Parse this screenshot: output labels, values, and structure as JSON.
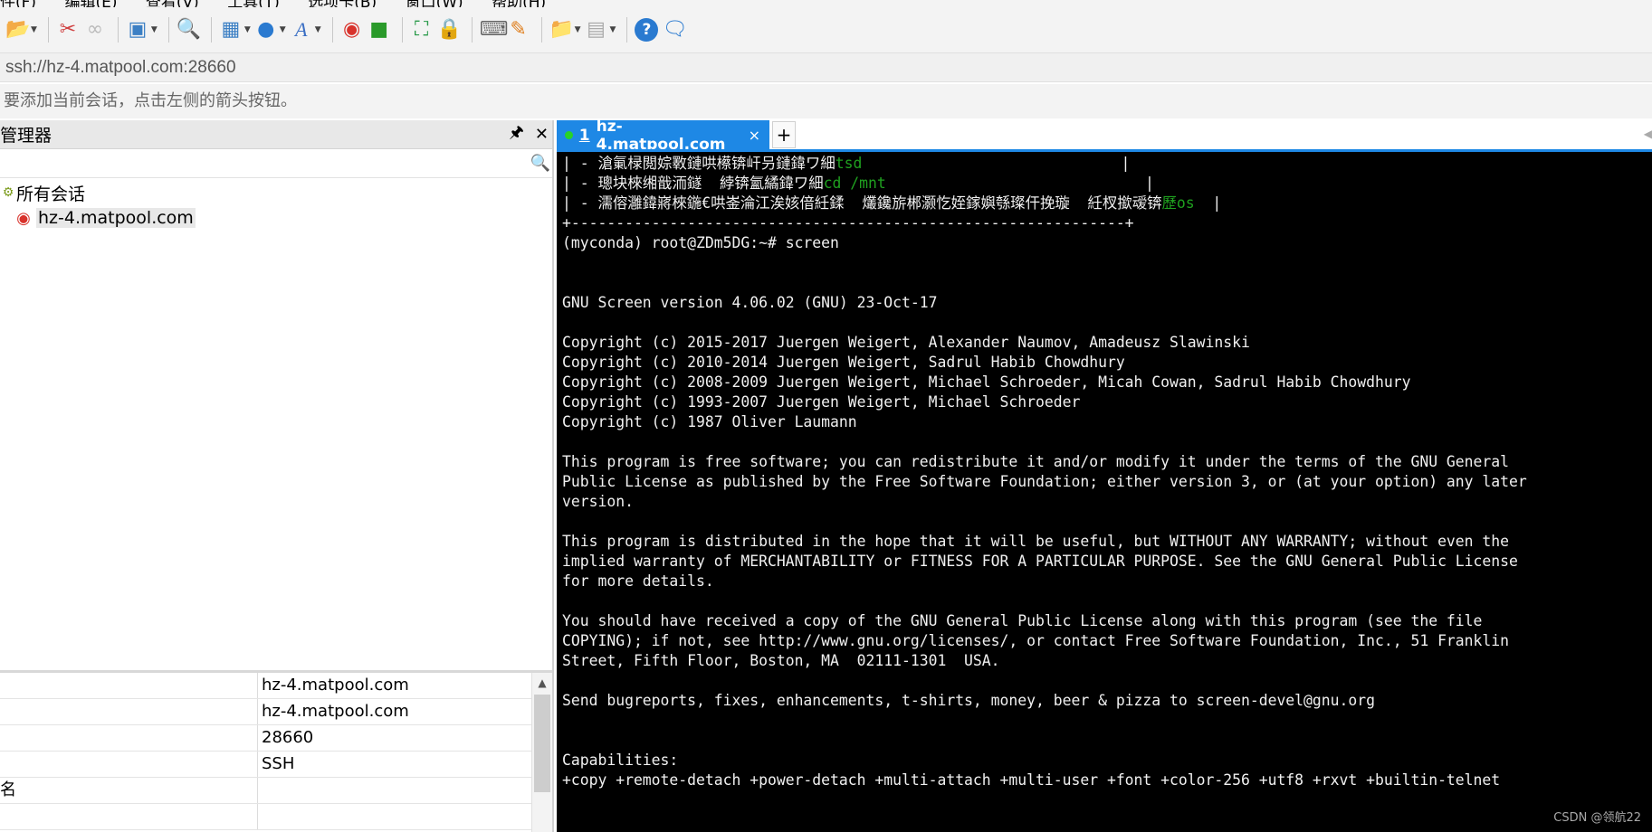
{
  "menubar": {
    "items": [
      "件(F)",
      "编辑(E)",
      "查看(V)",
      "工具(T)",
      "选项卡(B)",
      "窗口(W)",
      "帮助(H)"
    ]
  },
  "toolbar": {
    "icons": [
      "folder-icon",
      "disconnect-icon",
      "reconnect-icon",
      "new-session-icon",
      "find-icon",
      "layout-icon",
      "globe-icon",
      "font-icon",
      "xftp-icon",
      "xshell-green-icon",
      "fullscreen-icon",
      "lock-icon",
      "keyboard-icon",
      "highlight-icon",
      "transfer-icon",
      "tile-icon",
      "help-icon",
      "chat-icon"
    ]
  },
  "address": {
    "value": "ssh://hz-4.matpool.com:28660"
  },
  "hint": {
    "text": "要添加当前会话，点击左侧的箭头按钮。"
  },
  "session_manager": {
    "title": "管理器",
    "pin_label": "📌",
    "close_label": "✕",
    "search_placeholder": "",
    "tree": {
      "root_label": "所有会话",
      "host_label": "hz-4.matpool.com"
    },
    "properties": [
      {
        "key": "",
        "value": "hz-4.matpool.com"
      },
      {
        "key": "",
        "value": "hz-4.matpool.com"
      },
      {
        "key": "",
        "value": "28660"
      },
      {
        "key": "",
        "value": "SSH"
      },
      {
        "key": "名",
        "value": ""
      },
      {
        "key": "",
        "value": ""
      }
    ]
  },
  "tabs": [
    {
      "number": "1",
      "label": "hz-4.matpool.com",
      "status_color": "#28d228",
      "close": "×"
    }
  ],
  "tab_add": "+",
  "terminal": {
    "lines": [
      {
        "text": "| - 滄氭椂閲婃斁鏈哄櫒锛屽叧鏈鍏ワ細",
        "green": "tsd",
        "tail": "                             |"
      },
      {
        "text": "| - 璁块棶缃戠洏鐩  綍锛氳繘鍏ワ細",
        "green": "cd /mnt",
        "tail": "                             |"
      },
      {
        "text": "| - 濡傛灉鍏嶈棶鍦€哄崟淪江涘姟偣紝鍒  爜鑱旂郴灏忔姪鎵嬩綔璨仠挽璇  紝杈撳叆锛",
        "green": "歷os",
        "tail": "  |"
      },
      {
        "text": "+--------------------------------------------------------------+",
        "green": "",
        "tail": ""
      },
      {
        "text": "(myconda) root@ZDm5DG:~# screen",
        "green": "",
        "tail": ""
      },
      {
        "text": "",
        "green": "",
        "tail": ""
      },
      {
        "text": "",
        "green": "",
        "tail": ""
      },
      {
        "text": "GNU Screen version 4.06.02 (GNU) 23-Oct-17",
        "green": "",
        "tail": ""
      },
      {
        "text": "",
        "green": "",
        "tail": ""
      },
      {
        "text": "Copyright (c) 2015-2017 Juergen Weigert, Alexander Naumov, Amadeusz Slawinski",
        "green": "",
        "tail": ""
      },
      {
        "text": "Copyright (c) 2010-2014 Juergen Weigert, Sadrul Habib Chowdhury",
        "green": "",
        "tail": ""
      },
      {
        "text": "Copyright (c) 2008-2009 Juergen Weigert, Michael Schroeder, Micah Cowan, Sadrul Habib Chowdhury",
        "green": "",
        "tail": ""
      },
      {
        "text": "Copyright (c) 1993-2007 Juergen Weigert, Michael Schroeder",
        "green": "",
        "tail": ""
      },
      {
        "text": "Copyright (c) 1987 Oliver Laumann",
        "green": "",
        "tail": ""
      },
      {
        "text": "",
        "green": "",
        "tail": ""
      },
      {
        "text": "This program is free software; you can redistribute it and/or modify it under the terms of the GNU General",
        "green": "",
        "tail": ""
      },
      {
        "text": "Public License as published by the Free Software Foundation; either version 3, or (at your option) any later",
        "green": "",
        "tail": ""
      },
      {
        "text": "version.",
        "green": "",
        "tail": ""
      },
      {
        "text": "",
        "green": "",
        "tail": ""
      },
      {
        "text": "This program is distributed in the hope that it will be useful, but WITHOUT ANY WARRANTY; without even the",
        "green": "",
        "tail": ""
      },
      {
        "text": "implied warranty of MERCHANTABILITY or FITNESS FOR A PARTICULAR PURPOSE. See the GNU General Public License",
        "green": "",
        "tail": ""
      },
      {
        "text": "for more details.",
        "green": "",
        "tail": ""
      },
      {
        "text": "",
        "green": "",
        "tail": ""
      },
      {
        "text": "You should have received a copy of the GNU General Public License along with this program (see the file",
        "green": "",
        "tail": ""
      },
      {
        "text": "COPYING); if not, see http://www.gnu.org/licenses/, or contact Free Software Foundation, Inc., 51 Franklin",
        "green": "",
        "tail": ""
      },
      {
        "text": "Street, Fifth Floor, Boston, MA  02111-1301  USA.",
        "green": "",
        "tail": ""
      },
      {
        "text": "",
        "green": "",
        "tail": ""
      },
      {
        "text": "Send bugreports, fixes, enhancements, t-shirts, money, beer & pizza to screen-devel@gnu.org",
        "green": "",
        "tail": ""
      },
      {
        "text": "",
        "green": "",
        "tail": ""
      },
      {
        "text": "",
        "green": "",
        "tail": ""
      },
      {
        "text": "Capabilities:",
        "green": "",
        "tail": ""
      },
      {
        "text": "+copy +remote-detach +power-detach +multi-attach +multi-user +font +color-256 +utf8 +rxvt +builtin-telnet",
        "green": "",
        "tail": ""
      }
    ],
    "watermark": "CSDN @领航22"
  },
  "colors": {
    "accent": "#1e88e5",
    "terminal_bg": "#000000",
    "terminal_fg": "#f0f0f0",
    "terminal_green": "#1fa01f"
  }
}
